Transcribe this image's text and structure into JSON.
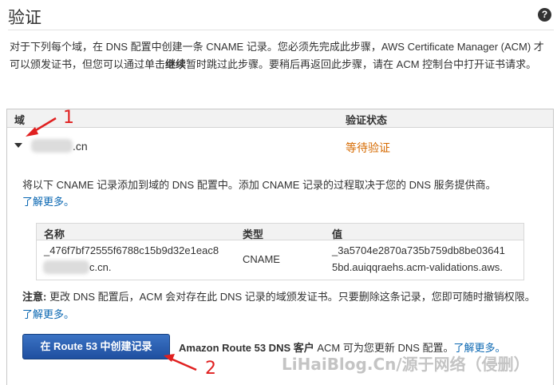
{
  "page": {
    "title": "验证",
    "help_icon_label": "?",
    "intro_part1": "对于下列每个域，在 DNS 配置中创建一条 CNAME 记录。您必须先完成此步骤，AWS Certificate Manager (ACM) 才可以颁发证书，但您可以通过单击",
    "intro_bold": "继续",
    "intro_part2": "暂时跳过此步骤。要稍后再返回此步骤，请在 ACM 控制台中打开证书请求。"
  },
  "table": {
    "col_domain": "域",
    "col_status": "验证状态",
    "row": {
      "domain_suffix": ".cn",
      "status": "等待验证",
      "status_color": "#d66a00"
    }
  },
  "detail": {
    "text": "将以下 CNAME 记录添加到域的 DNS 配置中。添加 CNAME 记录的过程取决于您的 DNS 服务提供商。",
    "learn_more": "了解更多。",
    "records": {
      "col_name": "名称",
      "col_type": "类型",
      "col_value": "值",
      "name_line1": "_476f7bf72555f6788c15b9d32e1eac8",
      "name_line2": "c.cn.",
      "type": "CNAME",
      "value_line1": "_3a5704e2870a735b759db8be03641",
      "value_line2": "5bd.auiqqraehs.acm-validations.aws."
    }
  },
  "note": {
    "label": "注意:",
    "text": "更改 DNS 配置后，ACM 会对存在此 DNS 记录的域颁发证书。只要删除这条记录，您即可随时撤销权限。",
    "learn_more": "了解更多。"
  },
  "actions": {
    "create_button": "在 Route 53 中创建记录",
    "button_note_bold": "Amazon Route 53 DNS 客户",
    "button_note_text": " ACM 可为您更新 DNS 配置。",
    "learn_more": "了解更多。"
  },
  "annotations": {
    "marker_1": "1",
    "marker_2": "2",
    "color": "#e02020"
  },
  "watermark": "LiHaiBlog.Cn/源于网络（侵删）",
  "colors": {
    "link": "#0a67b2",
    "button": "#2a5eb0"
  }
}
